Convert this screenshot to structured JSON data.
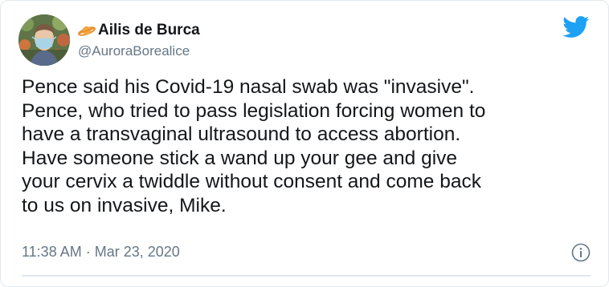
{
  "author": {
    "display_name": "Ailis de Burca",
    "handle": "@AuroraBorealice",
    "name_emoji_icon": "ringed-planet-icon",
    "avatar": "profile-photo"
  },
  "brand": {
    "logo_icon": "twitter-bird-icon",
    "accent_color": "#1DA1F2"
  },
  "tweet": {
    "text_lines": [
      "Pence said his Covid-19 nasal swab was \"invasive\".",
      "Pence, who tried to pass legislation forcing women to",
      "have a transvaginal ultrasound to access abortion.",
      "Have someone stick a wand up your gee and give",
      "your cervix a twiddle without consent and come back",
      "to us on invasive, Mike."
    ],
    "timestamp": "11:38 AM · Mar 23, 2020",
    "info_icon": "info-icon"
  },
  "colors": {
    "text": "#14171A",
    "secondary_text": "#657786",
    "divider": "#E1E8ED"
  }
}
